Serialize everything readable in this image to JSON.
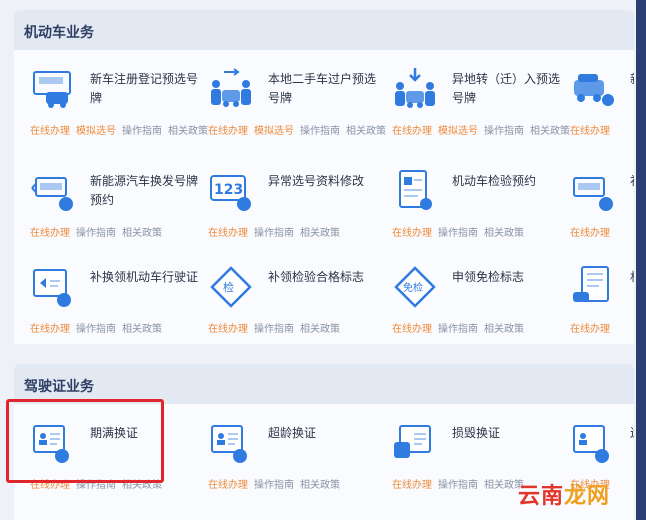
{
  "sections": {
    "motor": {
      "title": "机动车业务"
    },
    "license": {
      "title": "驾驶证业务"
    }
  },
  "links": {
    "online": "在线办理",
    "simulate": "模拟选号",
    "guide": "操作指南",
    "policy": "相关政策"
  },
  "motor_services": [
    {
      "name": "新车注册登记预选号牌",
      "icon": "new-car-plate-icon"
    },
    {
      "name": "本地二手车过户预选号牌",
      "icon": "car-transfer-icon"
    },
    {
      "name": "异地转（迁）入预选号牌",
      "icon": "car-move-in-icon"
    },
    {
      "name": "新",
      "icon": "car-plate-icon"
    },
    {
      "name": "新能源汽车换发号牌预约",
      "icon": "ev-plate-icon"
    },
    {
      "name": "异常选号资料修改",
      "icon": "number-123-icon"
    },
    {
      "name": "机动车检验预约",
      "icon": "inspection-doc-icon"
    },
    {
      "name": "补",
      "icon": "plate-reissue-icon"
    },
    {
      "name": "补换领机动车行驶证",
      "icon": "driving-permit-icon"
    },
    {
      "name": "补领检验合格标志",
      "icon": "inspection-mark-icon"
    },
    {
      "name": "申领免检标志",
      "icon": "exempt-mark-icon"
    },
    {
      "name": "机",
      "icon": "vehicle-doc-icon"
    }
  ],
  "license_services": [
    {
      "name": "期满换证",
      "icon": "id-card-expired-icon"
    },
    {
      "name": "超龄换证",
      "icon": "id-card-age-icon"
    },
    {
      "name": "损毁换证",
      "icon": "id-card-damaged-icon"
    },
    {
      "name": "遗",
      "icon": "id-card-lost-icon"
    }
  ],
  "watermark": {
    "part1": "云南",
    "part2": "龙网"
  },
  "colors": {
    "accent": "#2f7be0",
    "link_orange": "#ef8a3a",
    "highlight_red": "#e0262a"
  }
}
